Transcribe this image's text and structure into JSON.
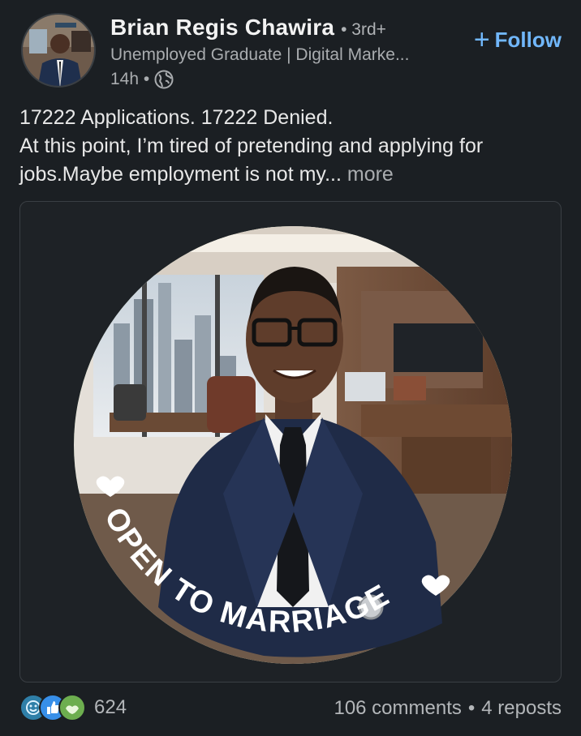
{
  "post": {
    "author": {
      "name": "Brian Regis Chawira",
      "degree": "• 3rd+",
      "headline": "Unemployed Graduate | Digital Marke...",
      "time": "14h •",
      "visibility_icon": "globe-icon"
    },
    "follow_label": "Follow",
    "text": {
      "line1": "17222 Applications. 17222 Denied.",
      "line2": "At this point, I’m tired of pretending and applying for",
      "line3": "jobs.Maybe employment is not my...",
      "more": "more"
    },
    "image": {
      "frame_text": "OPEN TO MARRIAGE",
      "frame_color": "#3f6e3a"
    },
    "reactions": {
      "icons": [
        "celebrate-icon",
        "like-icon",
        "support-icon"
      ],
      "count": "624"
    },
    "stats": {
      "comments": "106 comments",
      "separator": "•",
      "reposts": "4 reposts"
    }
  },
  "colors": {
    "background": "#1b1f23",
    "accent": "#71b7fb",
    "muted_text": "#a9acaf"
  }
}
